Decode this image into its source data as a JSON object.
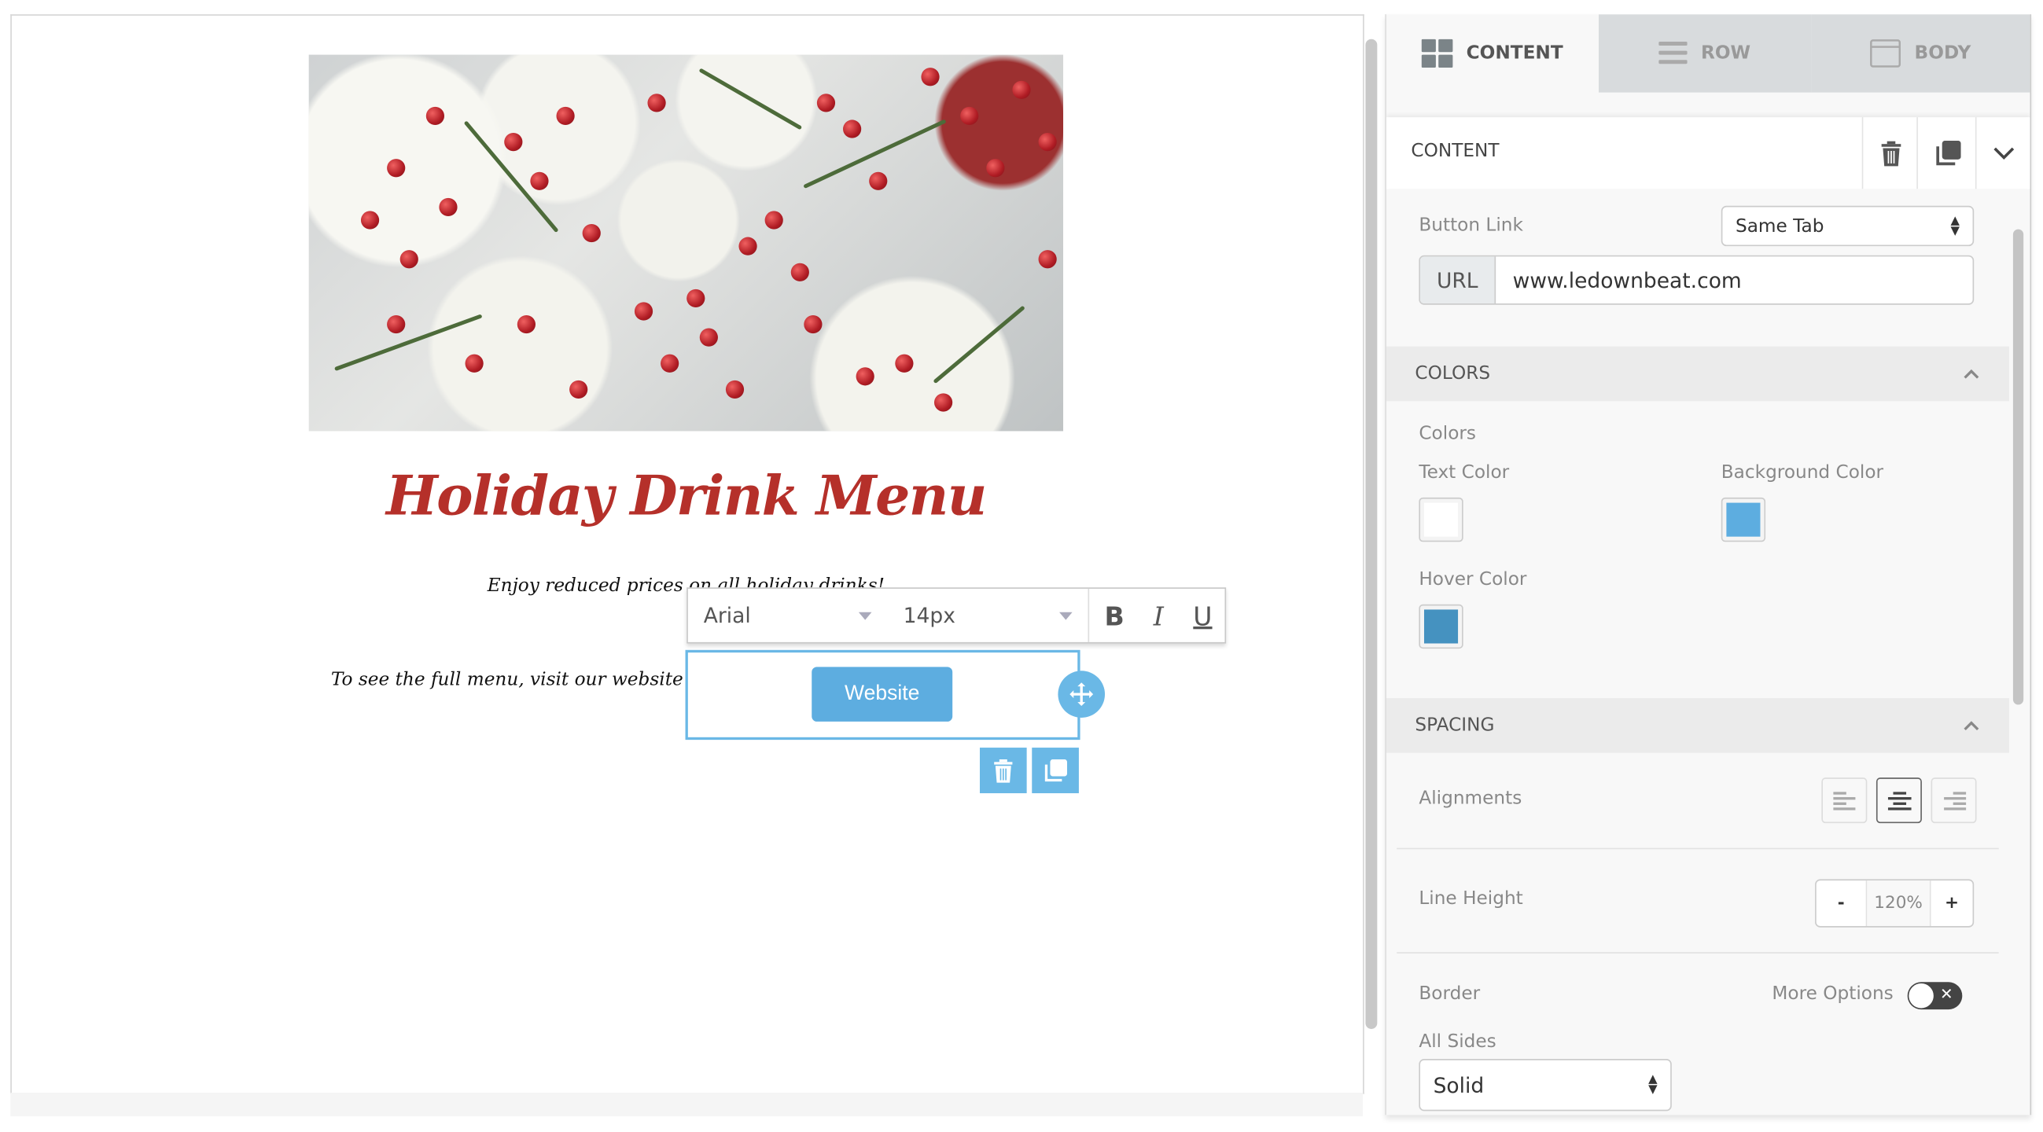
{
  "canvas": {
    "title": "Holiday Drink Menu",
    "subtitle": "Enjoy reduced prices on all holiday drinks!",
    "left_text": "To see the full menu, visit our website -->",
    "button_label": "Website",
    "toolbar": {
      "font": "Arial",
      "size": "14px",
      "bold": "B",
      "italic": "I",
      "underline": "U"
    }
  },
  "panel": {
    "tabs": [
      {
        "label": "CONTENT",
        "icon": "grid-icon",
        "active": true
      },
      {
        "label": "ROW",
        "icon": "rows-icon",
        "active": false
      },
      {
        "label": "BODY",
        "icon": "window-icon",
        "active": false
      }
    ],
    "header": "CONTENT",
    "button_link": {
      "label": "Button Link",
      "target": "Same Tab",
      "url_prefix": "URL",
      "url": "www.ledownbeat.com"
    },
    "colors": {
      "section": "COLORS",
      "label": "Colors",
      "text_color": {
        "label": "Text Color",
        "value": "#ffffff"
      },
      "background_color": {
        "label": "Background Color",
        "value": "#5dade0"
      },
      "hover_color": {
        "label": "Hover Color",
        "value": "#4592c0"
      }
    },
    "spacing": {
      "section": "SPACING",
      "alignments": "Alignments",
      "alignment_selected": "center",
      "line_height": {
        "label": "Line Height",
        "minus": "-",
        "value": "120%",
        "plus": "+"
      },
      "border": {
        "label": "Border",
        "more_options": "More Options",
        "more_options_on": false,
        "all_sides": "All Sides",
        "style": "Solid"
      }
    }
  },
  "colors": {
    "accent": "#6ab8e6",
    "title": "#b5302a"
  }
}
